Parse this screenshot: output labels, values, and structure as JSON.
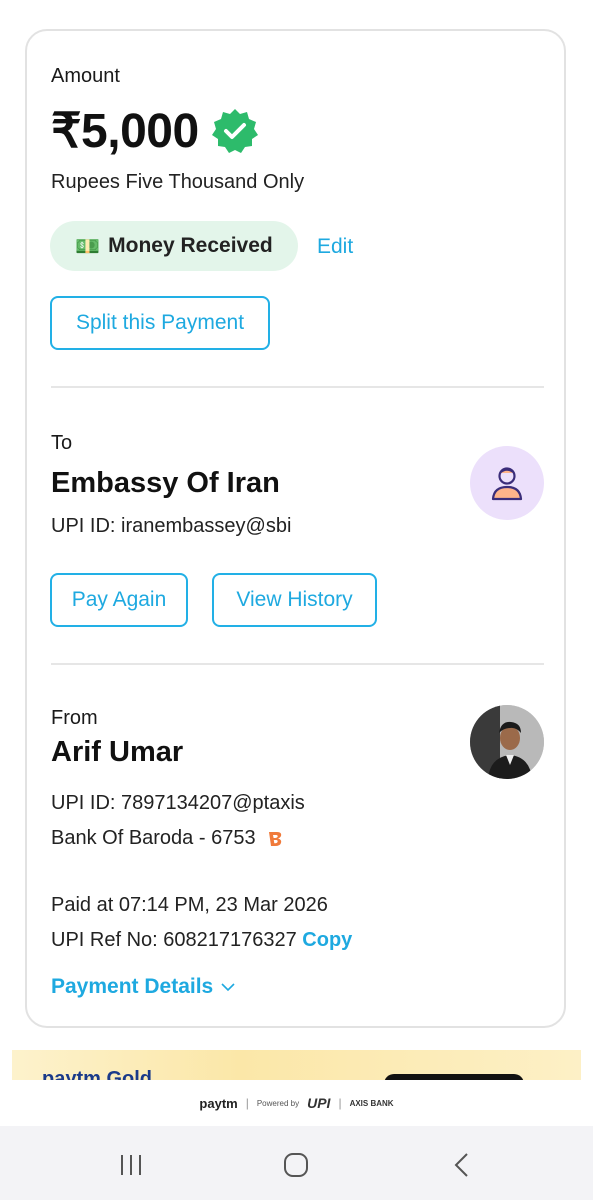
{
  "amount_section": {
    "label": "Amount",
    "value": "₹5,000",
    "in_words": "Rupees Five Thousand Only",
    "status_icon": "verified-badge-icon",
    "status_color": "#2dbb6b",
    "tag_icon": "money-icon",
    "tag_label": "Money Received",
    "edit_label": "Edit",
    "split_label": "Split this Payment"
  },
  "to_section": {
    "label": "To",
    "name": "Embassy Of Iran",
    "upi_id": "UPI ID: iranembassey@sbi",
    "avatar_icon": "user-icon",
    "pay_again_label": "Pay Again",
    "view_history_label": "View History"
  },
  "from_section": {
    "label": "From",
    "name": "Arif Umar",
    "upi_id": "UPI ID: 7897134207@ptaxis",
    "bank": "Bank Of Baroda - 6753",
    "bank_icon": "bank-of-baroda-logo",
    "paid_at": "Paid at 07:14 PM, 23 Mar 2026",
    "ref_label": "UPI Ref No: 608217176327",
    "copy_label": "Copy",
    "payment_details_label": "Payment Details"
  },
  "banner": {
    "text": "paytm Gold"
  },
  "footer": {
    "brand": "paytm",
    "powered_by": "Powered by",
    "upi": "UPI",
    "bank": "AXIS BANK"
  },
  "colors": {
    "accent": "#1ea9e0",
    "received_bg": "#e3f5ea",
    "avatar_bg": "#ece0fb"
  }
}
